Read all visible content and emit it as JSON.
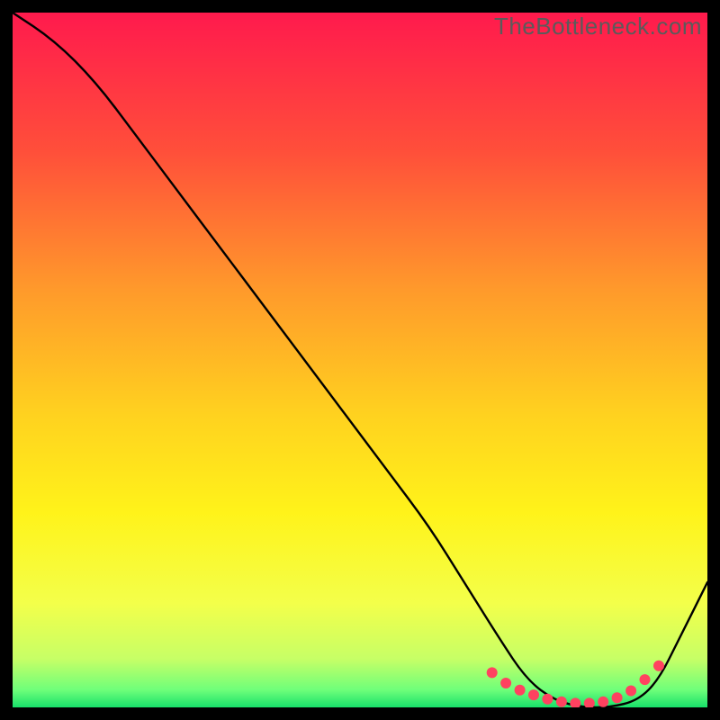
{
  "watermark": "TheBottleneck.com",
  "chart_data": {
    "type": "line",
    "title": "",
    "xlabel": "",
    "ylabel": "",
    "xlim": [
      0,
      100
    ],
    "ylim": [
      0,
      100
    ],
    "series": [
      {
        "name": "bottleneck-curve",
        "x": [
          0,
          6,
          12,
          18,
          24,
          30,
          36,
          42,
          48,
          54,
          60,
          65,
          70,
          74,
          78,
          82,
          86,
          90,
          93,
          96,
          100
        ],
        "y": [
          100,
          96,
          90,
          82,
          74,
          66,
          58,
          50,
          42,
          34,
          26,
          18,
          10,
          4,
          1,
          0,
          0,
          1,
          4,
          10,
          18
        ]
      }
    ],
    "highlight_points": {
      "x": [
        69,
        71,
        73,
        75,
        77,
        79,
        81,
        83,
        85,
        87,
        89,
        91,
        93
      ],
      "y": [
        5,
        3.5,
        2.5,
        1.8,
        1.2,
        0.8,
        0.6,
        0.6,
        0.8,
        1.4,
        2.4,
        4,
        6
      ]
    },
    "gradient_stops": [
      {
        "pos": 0.0,
        "color": "#ff1a4d"
      },
      {
        "pos": 0.2,
        "color": "#ff4f3a"
      },
      {
        "pos": 0.4,
        "color": "#ff9a2b"
      },
      {
        "pos": 0.58,
        "color": "#ffd21f"
      },
      {
        "pos": 0.72,
        "color": "#fff31a"
      },
      {
        "pos": 0.85,
        "color": "#f3ff4a"
      },
      {
        "pos": 0.93,
        "color": "#c7ff66"
      },
      {
        "pos": 0.975,
        "color": "#6eff7a"
      },
      {
        "pos": 1.0,
        "color": "#18e06a"
      }
    ]
  }
}
